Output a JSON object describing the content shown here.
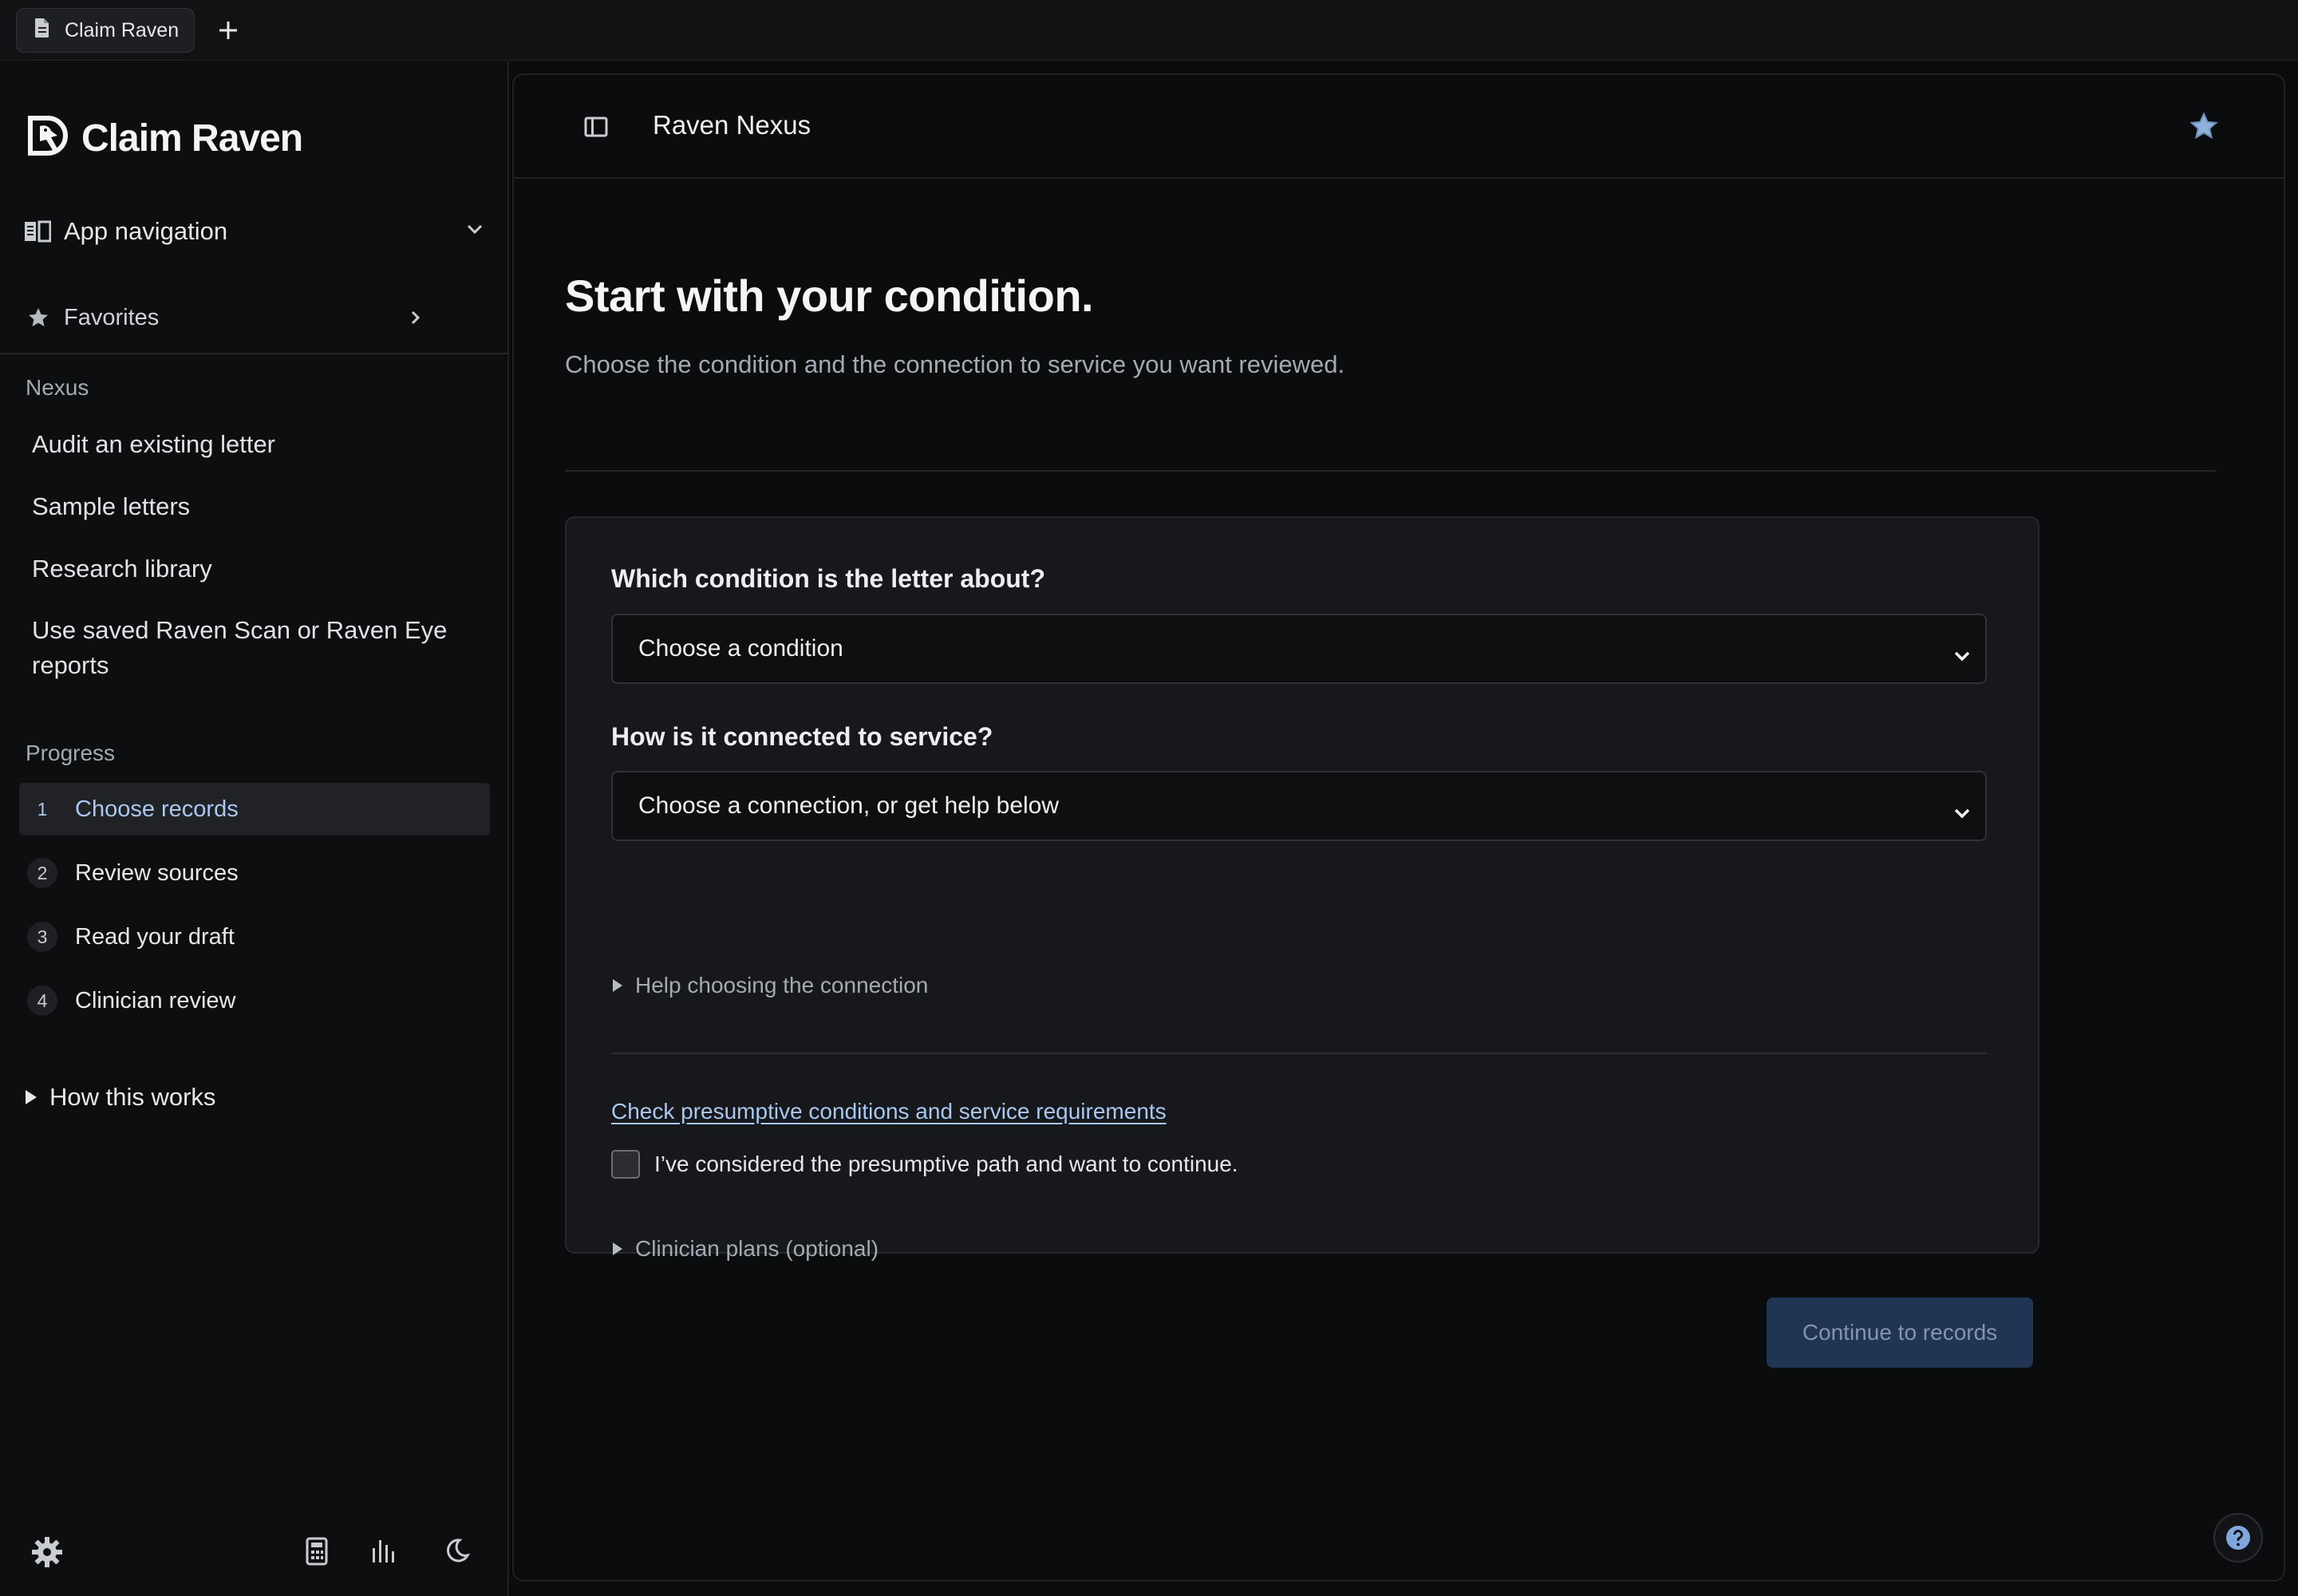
{
  "tabbar": {
    "tab_label": "Claim Raven"
  },
  "sidebar": {
    "logo_text": "Claim Raven",
    "app_navigation": "App navigation",
    "favorites": "Favorites",
    "nexus_label": "Nexus",
    "nexus_links": [
      "Audit an existing letter",
      "Sample letters",
      "Research library",
      "Use saved Raven Scan or Raven Eye reports"
    ],
    "progress_label": "Progress",
    "steps": [
      {
        "num": "1",
        "label": "Choose records",
        "active": true
      },
      {
        "num": "2",
        "label": "Review sources",
        "active": false
      },
      {
        "num": "3",
        "label": "Read your draft",
        "active": false
      },
      {
        "num": "4",
        "label": "Clinician review",
        "active": false
      }
    ],
    "how_this_works": "How this works"
  },
  "header": {
    "title": "Raven Nexus"
  },
  "main": {
    "title": "Start with your condition.",
    "subtitle": "Choose the condition and the connection to service you want reviewed.",
    "form": {
      "condition_question": "Which condition is the letter about?",
      "condition_select_value": "Choose a condition",
      "connection_question": "How is it connected to service?",
      "connection_select_value": "Choose a connection, or get help below",
      "help_disclosure": "Help choosing the connection",
      "presumptive_link": "Check presumptive conditions and service requirements",
      "consider_checkbox_label": "I’ve considered the presumptive path and want to continue.",
      "clinician_plans_disclosure": "Clinician plans (optional)"
    },
    "continue_button": "Continue to records"
  },
  "colors": {
    "background": "#0a0b0d",
    "accent_link": "#a9c7ef",
    "button_disabled_bg": "#1f3553",
    "favorite_star": "#8fb2dd"
  }
}
